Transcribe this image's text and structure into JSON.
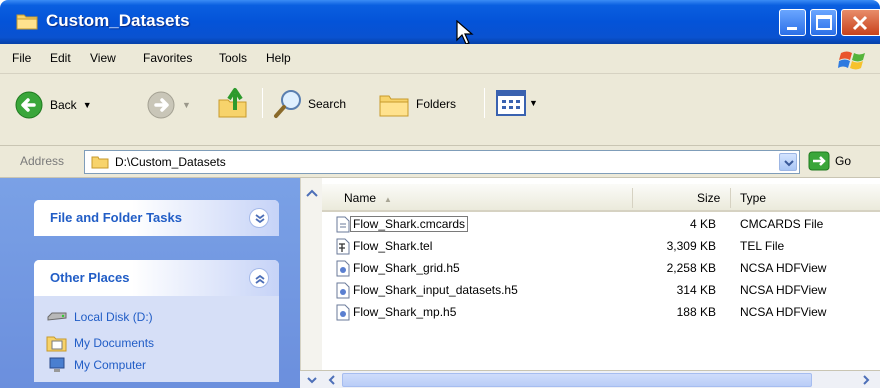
{
  "window": {
    "title": "Custom_Datasets"
  },
  "menu": [
    "File",
    "Edit",
    "View",
    "Favorites",
    "Tools",
    "Help"
  ],
  "toolbar": {
    "back": "Back",
    "search": "Search",
    "folders": "Folders"
  },
  "address": {
    "label": "Address",
    "value": "D:\\Custom_Datasets",
    "go": "Go"
  },
  "taskpane": {
    "file_tasks_header": "File and Folder Tasks",
    "other_places_header": "Other Places",
    "places": [
      "Local Disk (D:)",
      "My Documents",
      "My Computer"
    ]
  },
  "filelist": {
    "columns": {
      "name": "Name",
      "size": "Size",
      "type": "Type"
    },
    "files": [
      {
        "name": "Flow_Shark.cmcards",
        "size": "4 KB",
        "type": "CMCARDS File",
        "icon": "cmcards-file-icon"
      },
      {
        "name": "Flow_Shark.tel",
        "size": "3,309 KB",
        "type": "TEL File",
        "icon": "tel-file-icon"
      },
      {
        "name": "Flow_Shark_grid.h5",
        "size": "2,258 KB",
        "type": "NCSA HDFView",
        "icon": "hdf-file-icon"
      },
      {
        "name": "Flow_Shark_input_datasets.h5",
        "size": "314 KB",
        "type": "NCSA HDFView",
        "icon": "hdf-file-icon"
      },
      {
        "name": "Flow_Shark_mp.h5",
        "size": "188 KB",
        "type": "NCSA HDFView",
        "icon": "hdf-file-icon"
      }
    ]
  }
}
